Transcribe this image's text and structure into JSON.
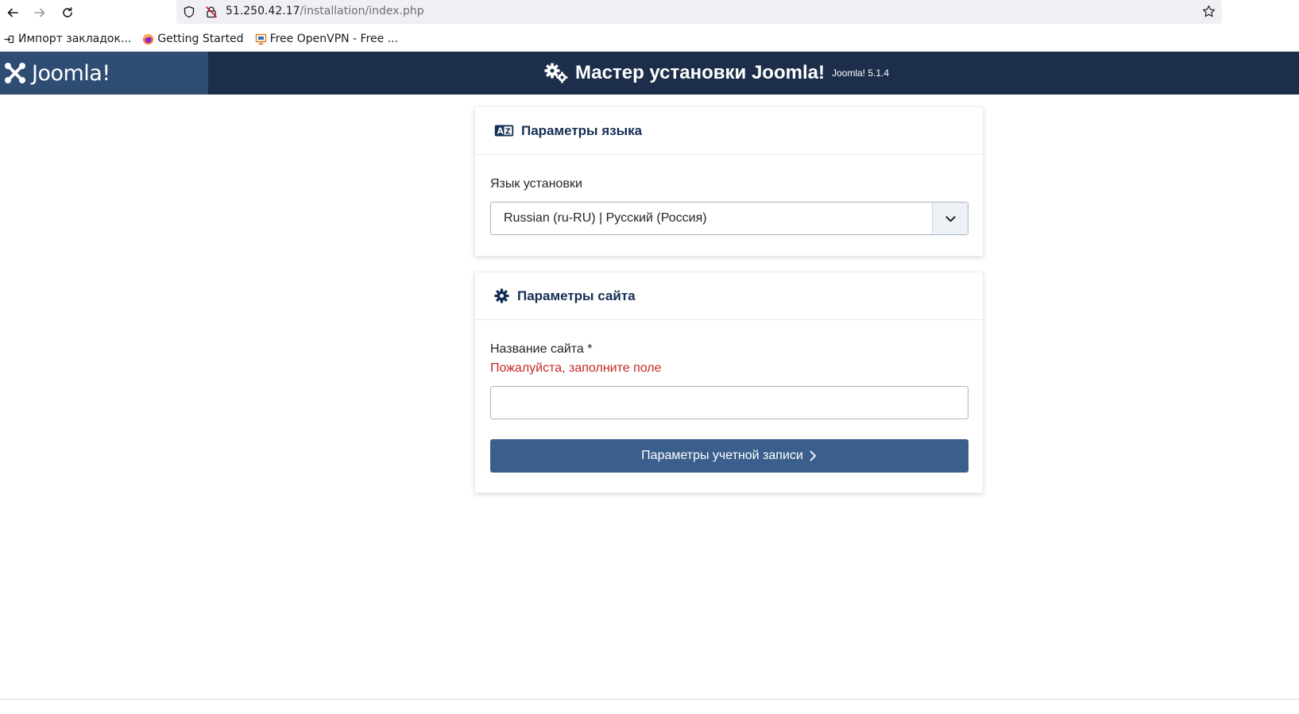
{
  "browser": {
    "url_host": "51.250.42.17",
    "url_path": "/installation/index.php",
    "bookmarks": [
      {
        "label": "Импорт закладок...",
        "icon": "import-icon"
      },
      {
        "label": "Getting Started",
        "icon": "firefox-icon"
      },
      {
        "label": "Free OpenVPN - Free ...",
        "icon": "openvpn-icon"
      }
    ]
  },
  "header": {
    "logo_text": "Joomla!",
    "title": "Мастер установки Joomla!",
    "version": "Joomla! 5.1.4",
    "colors": {
      "bar": "#1c2e4a",
      "logo_block": "#2f4d73"
    }
  },
  "language_card": {
    "title": "Параметры языка",
    "field_label": "Язык установки",
    "selected_language": "Russian (ru-RU) | Русский (Россия)"
  },
  "site_card": {
    "title": "Параметры сайта",
    "field_label": "Название сайта *",
    "error_text": "Пожалуйста, заполните поле",
    "site_name_value": "",
    "next_button_label": "Параметры учетной записи"
  },
  "colors": {
    "accent_button": "#3b5f8c",
    "error": "#c52827",
    "card_title": "#132f53"
  }
}
